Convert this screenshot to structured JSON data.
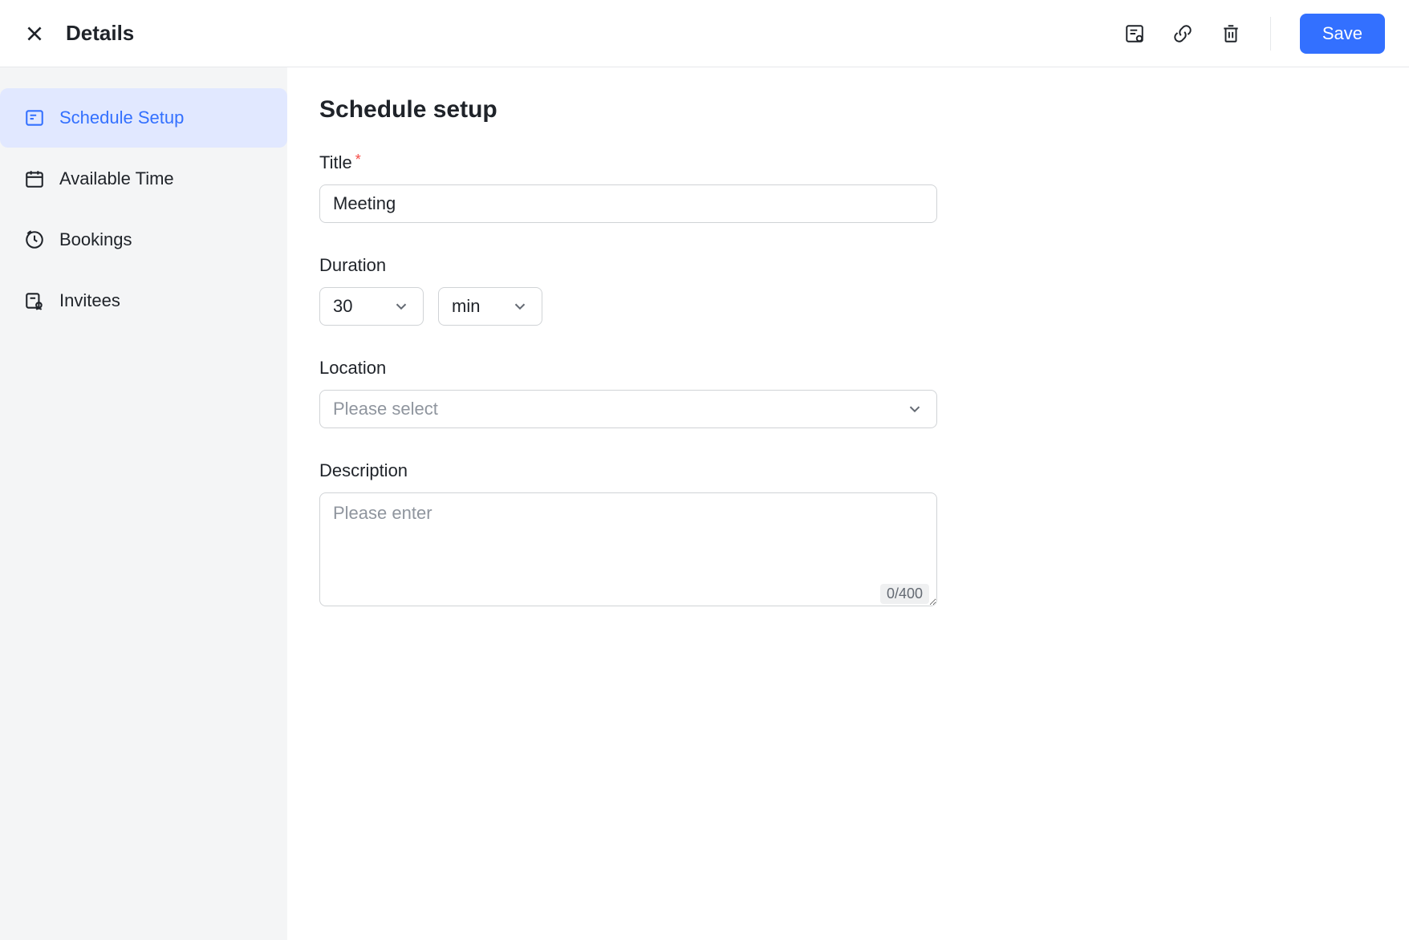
{
  "header": {
    "title": "Details",
    "save_label": "Save"
  },
  "sidebar": {
    "items": [
      {
        "label": "Schedule Setup"
      },
      {
        "label": "Available Time"
      },
      {
        "label": "Bookings"
      },
      {
        "label": "Invitees"
      }
    ]
  },
  "main": {
    "heading": "Schedule setup",
    "title_label": "Title",
    "title_value": "Meeting",
    "duration_label": "Duration",
    "duration_value": "30",
    "duration_unit": "min",
    "location_label": "Location",
    "location_placeholder": "Please select",
    "description_label": "Description",
    "description_placeholder": "Please enter",
    "description_counter": "0/400"
  }
}
